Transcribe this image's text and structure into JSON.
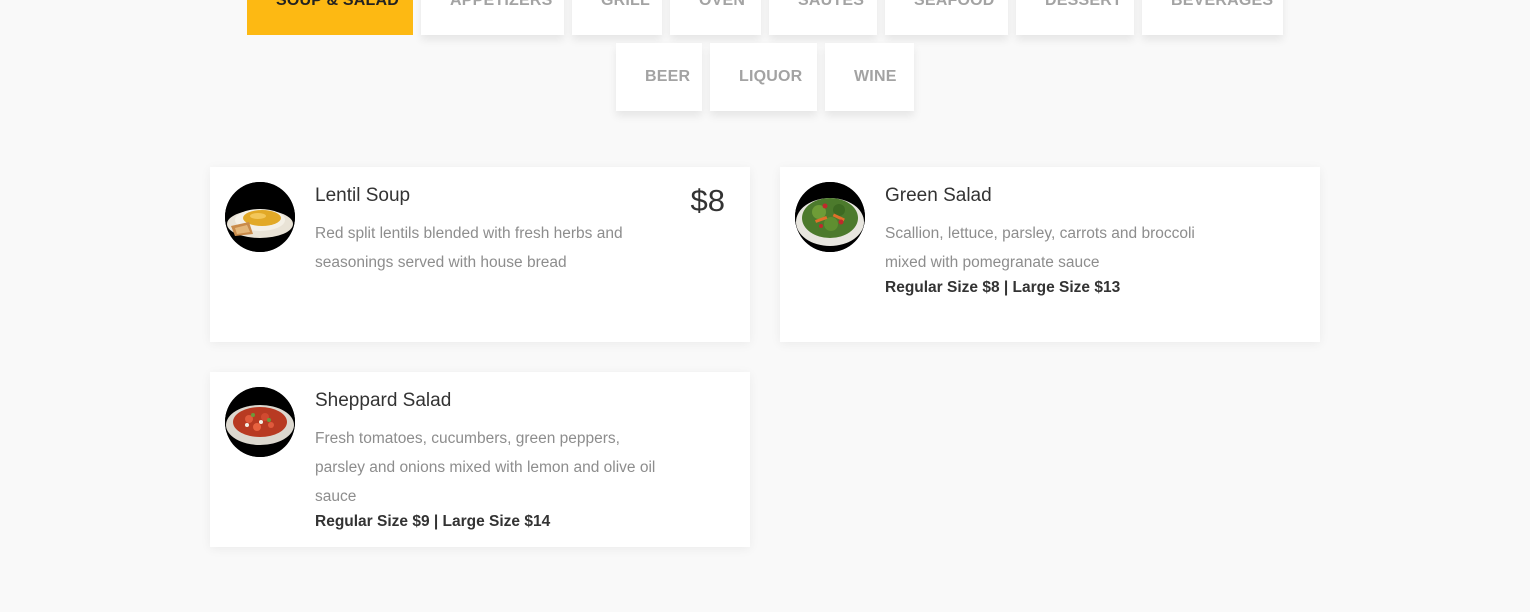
{
  "tabs": {
    "row1": [
      "SOUP & SALAD",
      "APPETIZERS",
      "GRILL",
      "OVEN",
      "SAUTES",
      "SEAFOOD",
      "DESSERT",
      "BEVERAGES"
    ],
    "row2": [
      "BEER",
      "LIQUOR",
      "WINE"
    ],
    "active": "SOUP & SALAD",
    "active_color": "#fdb913"
  },
  "menu_items": [
    {
      "name": "Lentil Soup",
      "description": "Red split lentils blended with fresh herbs and seasonings served with house bread",
      "price": "$8",
      "sizes": ""
    },
    {
      "name": "Green Salad",
      "description": "Scallion, lettuce, parsley, carrots and broccoli mixed with pomegranate sauce",
      "price": "",
      "sizes": "Regular Size $8 | Large Size $13"
    },
    {
      "name": "Sheppard Salad",
      "description": "Fresh tomatoes, cucumbers, green peppers, parsley and onions mixed with lemon and olive oil sauce",
      "price": "",
      "sizes": "Regular Size $9 | Large Size $14"
    }
  ]
}
